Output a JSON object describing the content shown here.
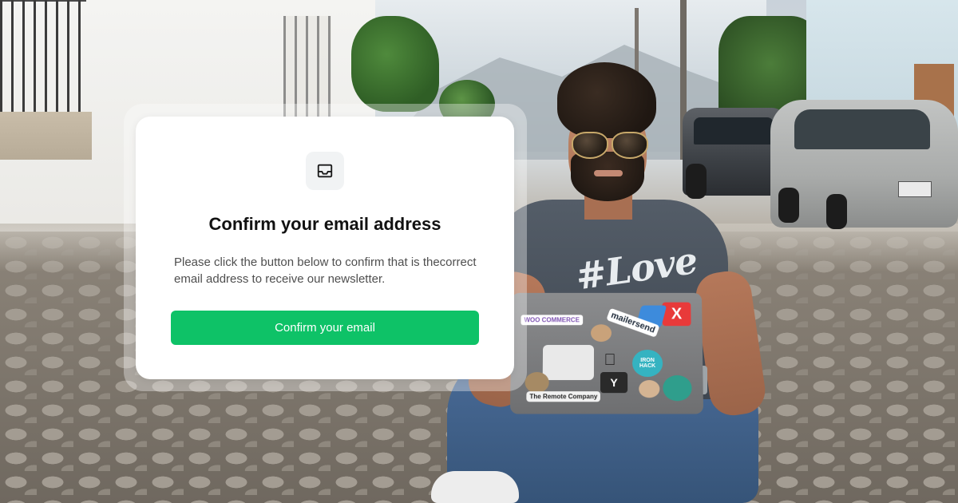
{
  "modal": {
    "icon": "inbox-tray-icon",
    "title": "Confirm your email address",
    "body": "Please click the button below to confirm that is thecorrect email address to receive our newsletter.",
    "button_label": "Confirm your email",
    "button_color": "#0ec267"
  },
  "laptop_stickers": {
    "woocommerce": "WOO COMMERCE",
    "mailersend": "mailersend",
    "ironhack": "IRON HACK",
    "remote": "The Remote Company"
  },
  "shirt_print": "#Love"
}
